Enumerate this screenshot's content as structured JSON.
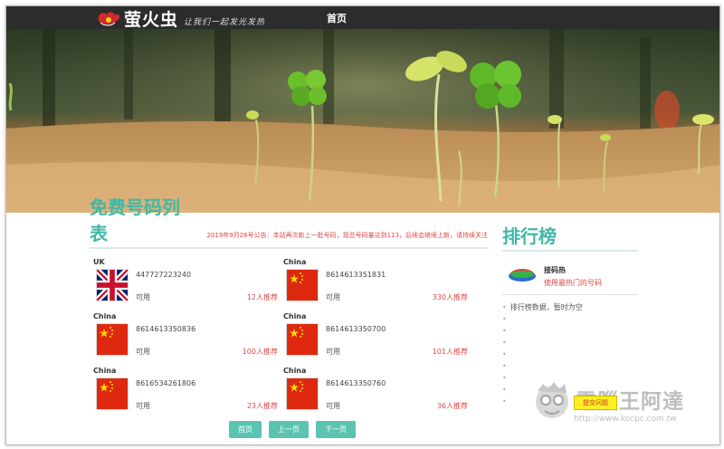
{
  "header": {
    "logo_text": "萤火虫",
    "slogan": "让我们一起发光发热",
    "nav_home": "首页"
  },
  "left": {
    "title": "免费号码列表",
    "notice": "2019年9月26号公告：本站再次新上一批号码，现总号码量达到113，后续会继续上新，请持续关注",
    "cards": [
      {
        "country": "UK",
        "flag": "uk",
        "number": "447727223240",
        "status": "可用",
        "rec": "12人推荐"
      },
      {
        "country": "China",
        "flag": "cn",
        "number": "8614613351831",
        "status": "可用",
        "rec": "330人推荐"
      },
      {
        "country": "China",
        "flag": "cn",
        "number": "8614613350836",
        "status": "可用",
        "rec": "100人推荐"
      },
      {
        "country": "China",
        "flag": "cn",
        "number": "8614613350700",
        "status": "可用",
        "rec": "101人推荐"
      },
      {
        "country": "China",
        "flag": "cn",
        "number": "8616534261806",
        "status": "可用",
        "rec": "23人推荐"
      },
      {
        "country": "China",
        "flag": "cn",
        "number": "8614613350760",
        "status": "可用",
        "rec": "36人推荐"
      }
    ],
    "pager": {
      "first": "首页",
      "prev": "上一页",
      "next": "下一页"
    }
  },
  "right": {
    "title": "排行榜",
    "top_name": "接码热",
    "top_sub": "使用最热门的号码",
    "empty_msg": "排行榜数据，暂时为空",
    "feedback": "提交问题"
  },
  "watermark": {
    "text": "電腦王阿達",
    "url": "http://www.kocpc.com.tw"
  },
  "colors": {
    "accent": "#40b8a8",
    "button": "#5bc4b0",
    "red": "#e04646",
    "topbar": "#2c2c2c"
  }
}
